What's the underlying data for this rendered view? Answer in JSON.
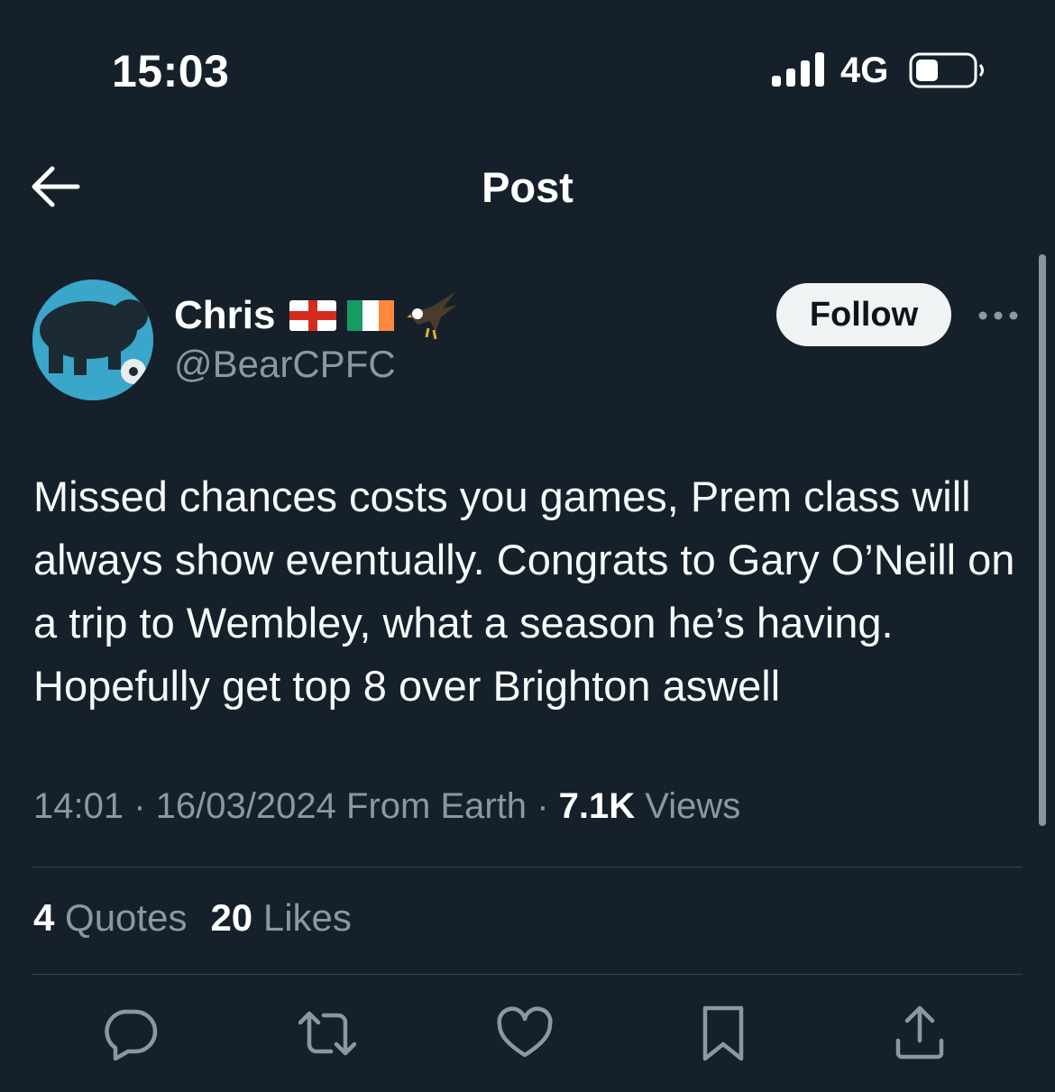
{
  "status_bar": {
    "time": "15:03",
    "network": "4G"
  },
  "header": {
    "title": "Post"
  },
  "author": {
    "name": "Chris",
    "handle": "@BearCPFC",
    "follow_label": "Follow"
  },
  "post": {
    "text": "Missed chances costs you games, Prem class will always show eventually. Congrats to Gary O’Neill on a trip to Wembley, what a season he’s having. Hopefully get top 8 over Brighton aswell",
    "time": "14:01",
    "date": "16/03/2024",
    "source": "From Earth",
    "separator": "·",
    "views_count": "7.1K",
    "views_label": "Views"
  },
  "stats": {
    "quotes_count": "4",
    "quotes_label": "Quotes",
    "likes_count": "20",
    "likes_label": "Likes"
  },
  "icons": [
    "signal-icon",
    "battery-icon",
    "back-arrow-icon",
    "england-flag-icon",
    "ireland-flag-icon",
    "eagle-icon",
    "more-icon",
    "reply-icon",
    "repost-icon",
    "like-icon",
    "bookmark-icon",
    "share-icon"
  ],
  "colors": {
    "background": "#15202b",
    "secondary_text": "#8899a6",
    "divider": "#38444d",
    "follow_bg": "#eff3f4"
  }
}
